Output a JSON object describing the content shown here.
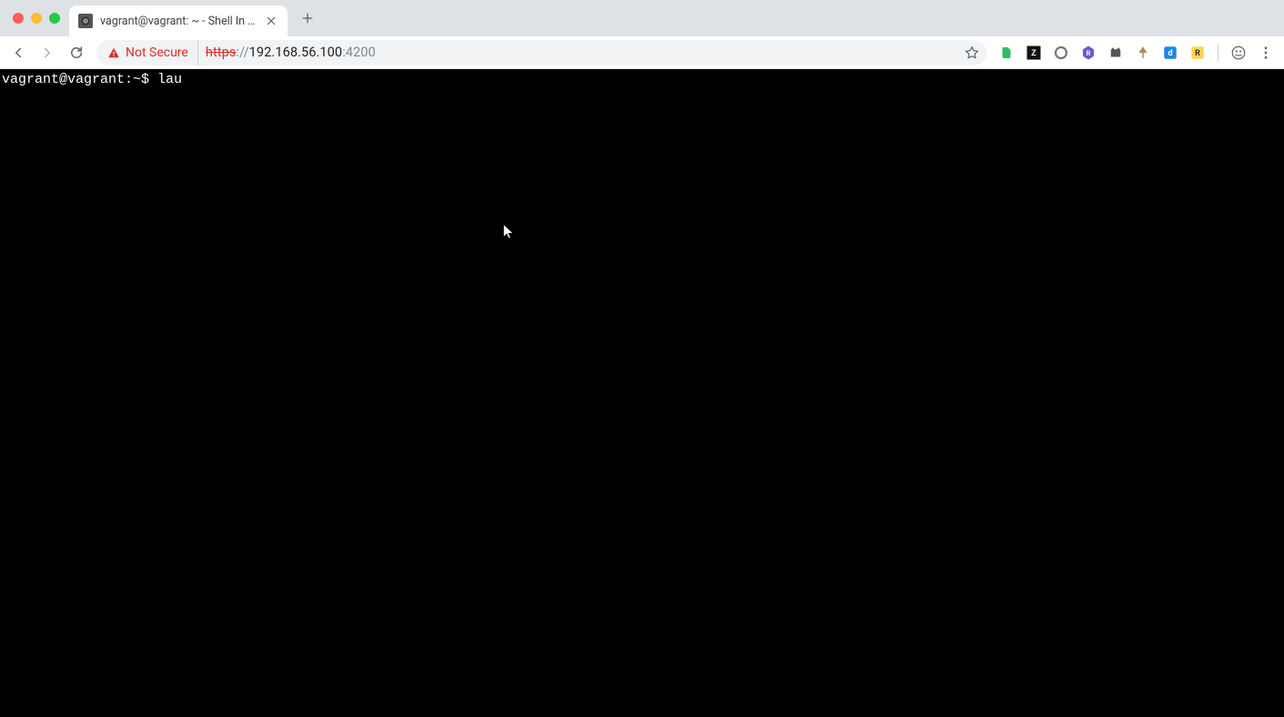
{
  "window": {
    "tab_title": "vagrant@vagrant: ~ - Shell In A Box"
  },
  "toolbar": {
    "security_label": "Not Secure",
    "url_scheme": "https",
    "url_scheme_sep": "://",
    "url_host": "192.168.56.100",
    "url_port": ":4200"
  },
  "extensions": {
    "items": [
      {
        "name": "evernote-icon"
      },
      {
        "name": "zotero-icon"
      },
      {
        "name": "circle-ext-icon"
      },
      {
        "name": "hex-ext-icon"
      },
      {
        "name": "cat-ext-icon"
      },
      {
        "name": "tree-ext-icon"
      },
      {
        "name": "d-ext-icon"
      },
      {
        "name": "r-ext-icon"
      }
    ]
  },
  "terminal": {
    "prompt": "vagrant@vagrant:~$ ",
    "command": "lau"
  }
}
